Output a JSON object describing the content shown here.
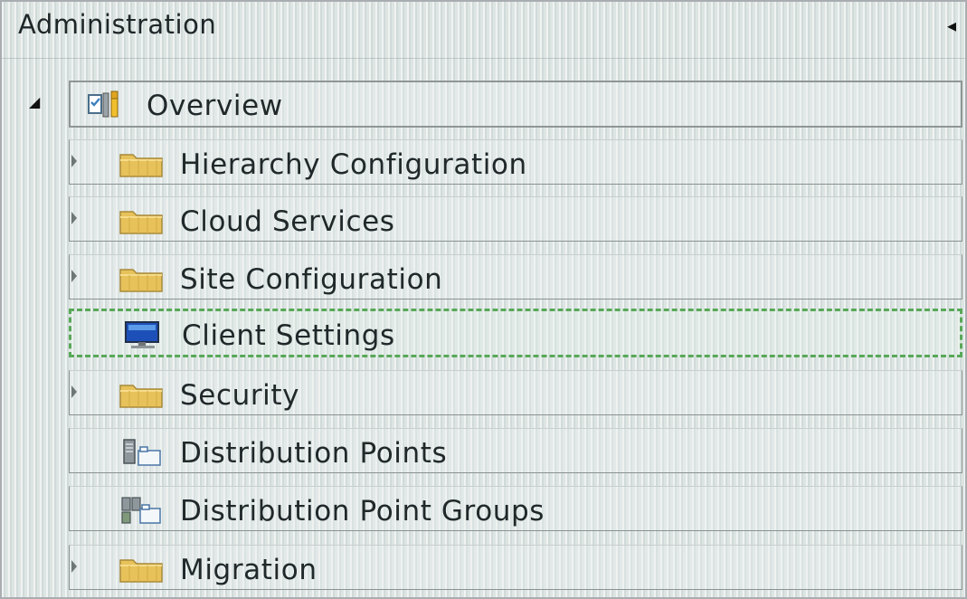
{
  "panel": {
    "title": "Administration",
    "collapse_glyph": "◂"
  },
  "tree": {
    "root_toggle_glyph": "◢",
    "root": {
      "label": "Overview",
      "icon": "overview-tools-icon"
    },
    "items": [
      {
        "label": "Hierarchy Configuration",
        "icon": "folder-icon",
        "expandable": true
      },
      {
        "label": "Cloud Services",
        "icon": "folder-icon",
        "expandable": true
      },
      {
        "label": "Site Configuration",
        "icon": "folder-icon",
        "expandable": true
      },
      {
        "label": "Client Settings",
        "icon": "monitor-icon",
        "expandable": false,
        "selected": true
      },
      {
        "label": "Security",
        "icon": "folder-icon",
        "expandable": true
      },
      {
        "label": "Distribution Points",
        "icon": "server-icon",
        "expandable": false
      },
      {
        "label": "Distribution Point Groups",
        "icon": "server-group-icon",
        "expandable": false
      },
      {
        "label": "Migration",
        "icon": "folder-icon",
        "expandable": true
      }
    ]
  },
  "colors": {
    "selection_dash": "#59a858",
    "folder_yellow": "#e9c65a",
    "text": "#20282a"
  }
}
